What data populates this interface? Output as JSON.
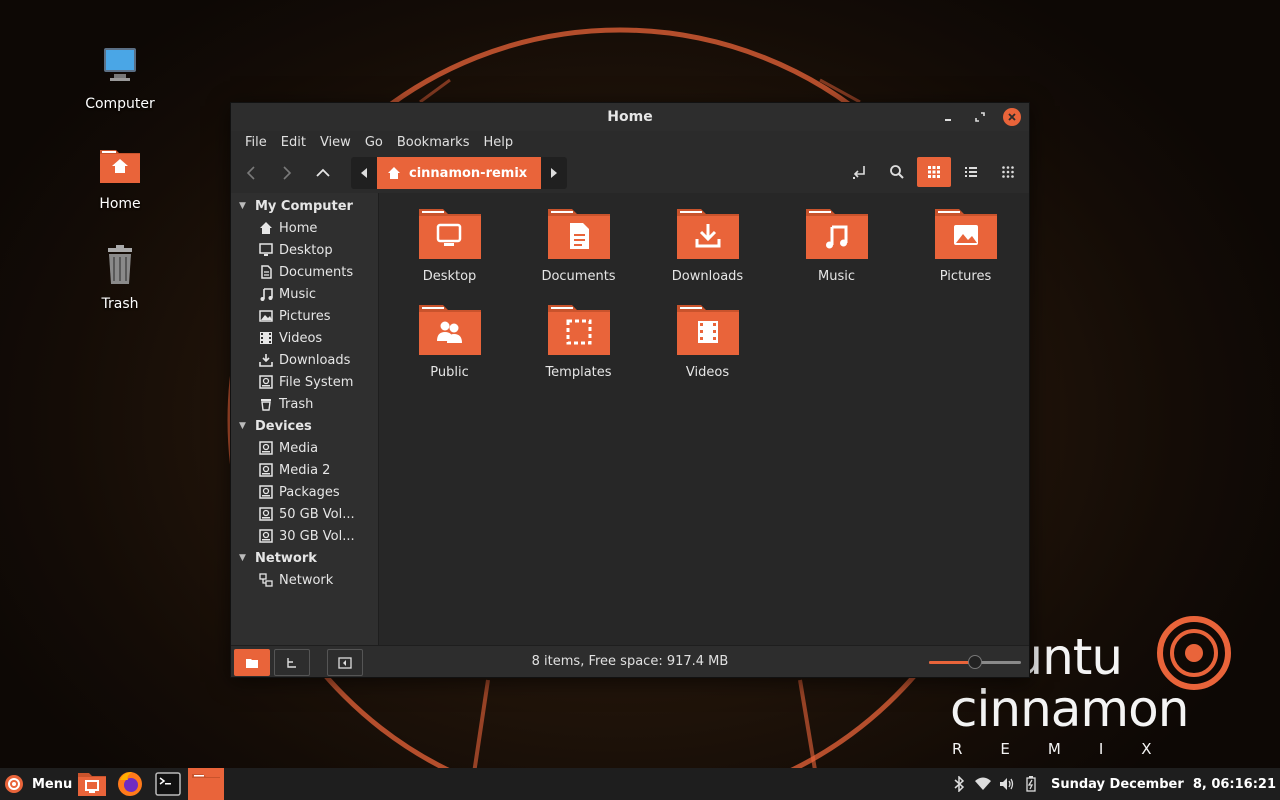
{
  "desktop": {
    "icons": [
      {
        "label": "Computer"
      },
      {
        "label": "Home"
      },
      {
        "label": "Trash"
      }
    ],
    "brand": {
      "line1": "ubuntu",
      "line2": "cinnamon",
      "line3": "REMIX"
    }
  },
  "window": {
    "title": "Home",
    "menu": [
      "File",
      "Edit",
      "View",
      "Go",
      "Bookmarks",
      "Help"
    ],
    "path": {
      "current": "cinnamon-remix"
    },
    "sidebar": {
      "sections": [
        {
          "title": "My Computer",
          "items": [
            "Home",
            "Desktop",
            "Documents",
            "Music",
            "Pictures",
            "Videos",
            "Downloads",
            "File System",
            "Trash"
          ]
        },
        {
          "title": "Devices",
          "items": [
            "Media",
            "Media 2",
            "Packages",
            "50 GB Vol...",
            "30 GB Vol..."
          ]
        },
        {
          "title": "Network",
          "items": [
            "Network"
          ]
        }
      ]
    },
    "files": [
      "Desktop",
      "Documents",
      "Downloads",
      "Music",
      "Pictures",
      "Public",
      "Templates",
      "Videos"
    ],
    "status": "8 items, Free space: 917.4 MB",
    "zoom_level": 0.5
  },
  "taskbar": {
    "menu_label": "Menu",
    "clock": "Sunday December  8, 06:16:21"
  },
  "colors": {
    "accent": "#e9643a",
    "panel": "#1e1e1e",
    "window_bg": "#2b2b2b"
  }
}
